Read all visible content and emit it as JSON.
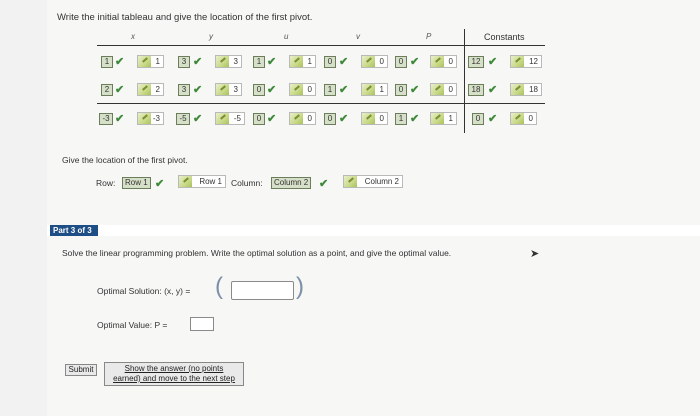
{
  "instruction": "Write the initial tableau and give the location of the first pivot.",
  "tableau": {
    "headers": [
      "x",
      "y",
      "u",
      "v",
      "P"
    ],
    "constants_header": "Constants",
    "rows": [
      {
        "given": [
          "1",
          "3",
          "1",
          "0",
          "0",
          "0",
          "12"
        ],
        "answers": [
          "1",
          "3",
          "1",
          "0",
          "0",
          "12"
        ]
      },
      {
        "given": [
          "2",
          "3",
          "0",
          "1",
          "0",
          "0",
          "18"
        ],
        "answers": [
          "2",
          "3",
          "0",
          "1",
          "0",
          "18"
        ]
      },
      {
        "given": [
          "-3",
          "-5",
          "0",
          "0",
          "1",
          "0",
          "0"
        ],
        "answers": [
          "-3",
          "-5",
          "0",
          "0",
          "1",
          "0"
        ]
      }
    ]
  },
  "pivot": {
    "prompt": "Give the location of the first pivot.",
    "row_label": "Row:",
    "row_given": "Row 1",
    "row_answer": "Row 1",
    "column_label": "Column:",
    "column_given": "Column 2",
    "column_answer": "Column 2"
  },
  "part": {
    "tag": "Part 3 of 3",
    "instruction": "Solve the linear programming problem. Write the optimal solution as a point, and give the optimal value.",
    "optimal_solution_label": "Optimal Solution: (x, y) =",
    "optimal_value_label": "Optimal Value: P =",
    "open_paren": "(",
    "close_paren": ")"
  },
  "buttons": {
    "submit": "Submit",
    "show_answer_line1": "Show the answer (no points",
    "show_answer_line2": "earned) and move to the next step"
  },
  "colors": {
    "check": "#3f8a3a",
    "part_tag": "#1e4e86"
  }
}
